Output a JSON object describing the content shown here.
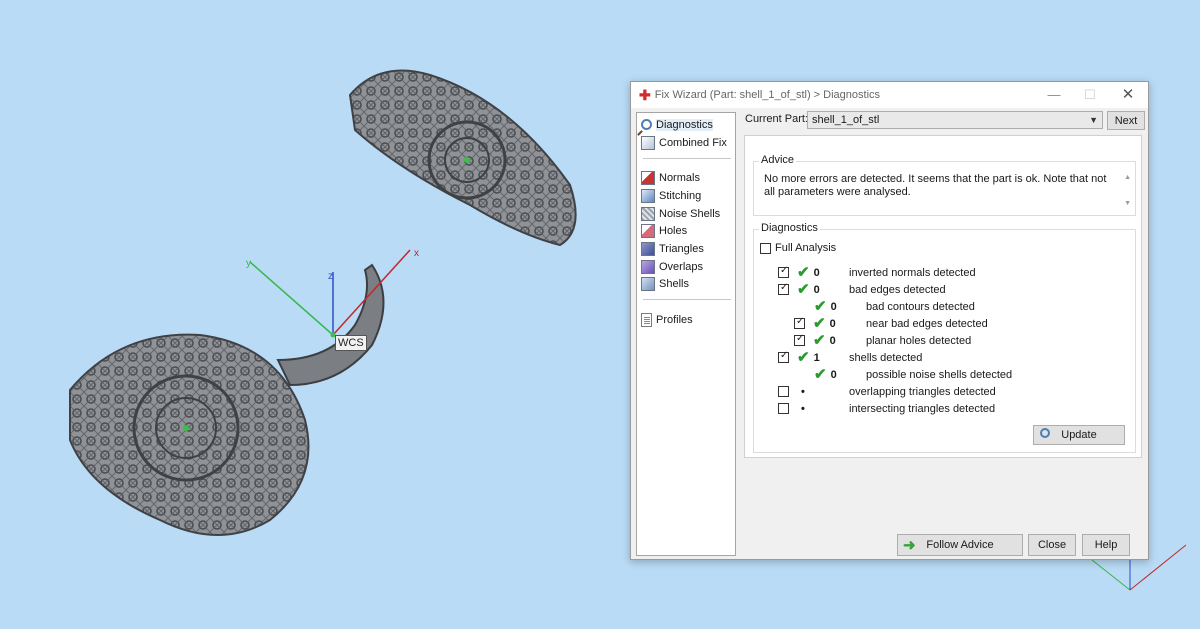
{
  "viewport": {
    "wcs_label": "WCS",
    "axis_x": "x",
    "axis_y": "y",
    "axis_z": "z"
  },
  "dialog": {
    "title": "Fix Wizard (Part: shell_1_of_stl) > Diagnostics",
    "sidebar": {
      "items": [
        {
          "label": "Diagnostics",
          "icon": "magnifier-icon"
        },
        {
          "label": "Combined Fix",
          "icon": "cube-icon"
        },
        {
          "label": "Normals",
          "icon": "normals-icon"
        },
        {
          "label": "Stitching",
          "icon": "stitching-icon"
        },
        {
          "label": "Noise Shells",
          "icon": "noise-shells-icon"
        },
        {
          "label": "Holes",
          "icon": "holes-icon"
        },
        {
          "label": "Triangles",
          "icon": "triangles-icon"
        },
        {
          "label": "Overlaps",
          "icon": "overlaps-icon"
        },
        {
          "label": "Shells",
          "icon": "shells-icon"
        },
        {
          "label": "Profiles",
          "icon": "profiles-icon"
        }
      ]
    },
    "current_part": {
      "label": "Current Part:",
      "value": "shell_1_of_stl",
      "next": "Next"
    },
    "advice": {
      "title": "Advice",
      "text": "No more errors are detected. It seems that the part is ok. Note that not all parameters were analysed."
    },
    "diagnostics": {
      "title": "Diagnostics",
      "full_analysis": "Full Analysis",
      "rows": [
        {
          "count": "0",
          "label": "inverted normals detected"
        },
        {
          "count": "0",
          "label": "bad edges detected"
        },
        {
          "count": "0",
          "label": "bad contours detected"
        },
        {
          "count": "0",
          "label": "near bad edges detected"
        },
        {
          "count": "0",
          "label": "planar holes detected"
        },
        {
          "count": "1",
          "label": "shells detected"
        },
        {
          "count": "0",
          "label": "possible noise shells detected"
        },
        {
          "count": "•",
          "label": "overlapping triangles detected"
        },
        {
          "count": "•",
          "label": "intersecting triangles detected"
        }
      ],
      "update": "Update"
    },
    "buttons": {
      "follow_advice": "Follow Advice",
      "close": "Close",
      "help": "Help"
    }
  },
  "colors": {
    "background": "#b9dbf5",
    "check_green": "#2c9a30",
    "axis_x": "#c0282d",
    "axis_y": "#36b84a",
    "axis_z": "#2d4fcc"
  }
}
